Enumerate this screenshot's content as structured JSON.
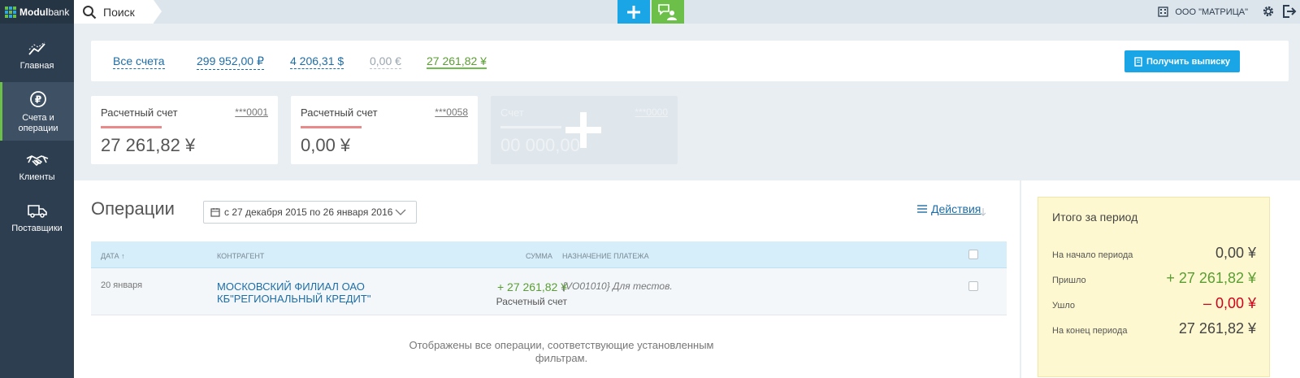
{
  "brand": {
    "name_bold": "Modul",
    "name_thin": "bank"
  },
  "sidebar": {
    "items": [
      {
        "label": "Главная"
      },
      {
        "label": "Счета и операции"
      },
      {
        "label": "Клиенты"
      },
      {
        "label": "Поставщики"
      }
    ]
  },
  "topbar": {
    "search_label": "Поиск",
    "company_name": "ООО \"МАТРИЦА\""
  },
  "balances": {
    "all_label": "Все счета",
    "rub": "299 952,00 ₽",
    "usd": "4 206,31 $",
    "eur": "0,00 €",
    "cny": "27 261,82 ¥",
    "statement_button": "Получить выписку"
  },
  "cards": [
    {
      "title": "Расчетный счет",
      "number": "***0001",
      "amount": "27 261,82 ¥"
    },
    {
      "title": "Расчетный счет",
      "number": "***0058",
      "amount": "0,00 ¥"
    },
    {
      "title": "Счет",
      "number": "***0000",
      "amount": "00 000,00"
    }
  ],
  "operations": {
    "title": "Операции",
    "date_range": "с 27 декабря 2015 по 26 января 2016",
    "actions_label": "Действия",
    "columns": {
      "date": "ДАТА",
      "contractor": "КОНТРАГЕНТ",
      "sum": "СУММА",
      "purpose": "НАЗНАЧЕНИЕ ПЛАТЕЖА"
    },
    "rows": [
      {
        "date": "20 января",
        "contractor": "МОСКОВСКИЙ ФИЛИАЛ ОАО КБ\"РЕГИОНАЛЬНЫЙ КРЕДИТ\"",
        "amount": "+ 27 261,82 ¥",
        "account": "Расчетный счет",
        "purpose": "{VO01010} Для тестов."
      }
    ],
    "footnote": "Отображены все операции, соответствующие установленным фильтрам."
  },
  "summary": {
    "title": "Итого за период",
    "lines": [
      {
        "label": "На начало периода",
        "value": "0,00  ¥"
      },
      {
        "label": "Пришло",
        "value": "+ 27 261,82 ¥"
      },
      {
        "label": "Ушло",
        "value": "– 0,00 ¥"
      },
      {
        "label": "На конец периода",
        "value": "27 261,82  ¥"
      }
    ]
  },
  "colors": {
    "sidebar": "#2d3e50",
    "accent_blue": "#1aa6e6",
    "accent_green": "#6cc04a",
    "income_green": "#5a9e33",
    "expense_red": "#d0021b"
  }
}
